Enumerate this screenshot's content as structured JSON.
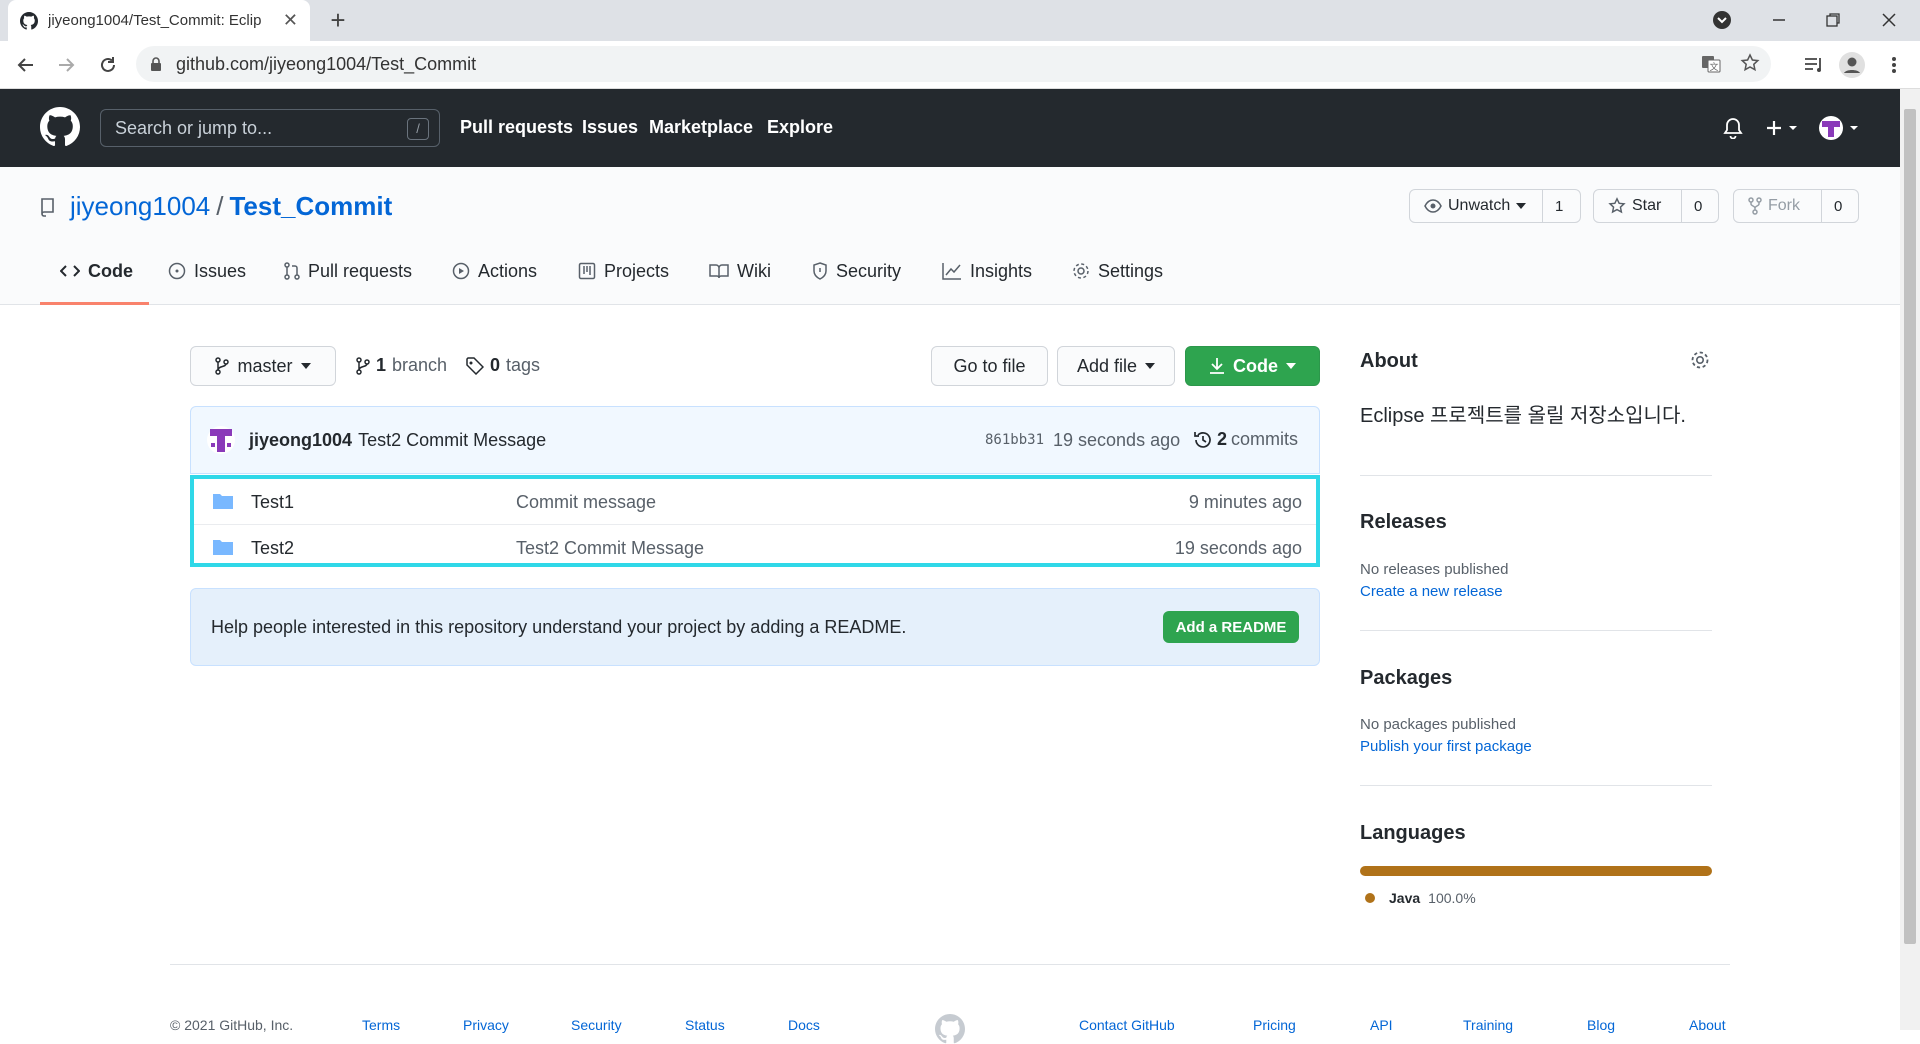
{
  "browser": {
    "tab_title": "jiyeong1004/Test_Commit: Eclip",
    "url": "github.com/jiyeong1004/Test_Commit",
    "new_tab": "+",
    "tab_close": "✕"
  },
  "header": {
    "search_placeholder": "Search or jump to...",
    "search_shortcut": "/",
    "nav": [
      "Pull requests",
      "Issues",
      "Marketplace",
      "Explore"
    ]
  },
  "repo": {
    "owner": "jiyeong1004",
    "separator": "/",
    "name": "Test_Commit",
    "unwatch_label": "Unwatch",
    "watch_count": "1",
    "star_label": "Star",
    "star_count": "0",
    "fork_label": "Fork",
    "fork_count": "0"
  },
  "tabs": [
    "Code",
    "Issues",
    "Pull requests",
    "Actions",
    "Projects",
    "Wiki",
    "Security",
    "Insights",
    "Settings"
  ],
  "toolbar": {
    "branch": "master",
    "branch_count": "1",
    "branch_label": "branch",
    "tag_count": "0",
    "tag_label": "tags",
    "go_to_file": "Go to file",
    "add_file": "Add file",
    "code": "Code"
  },
  "latest_commit": {
    "author": "jiyeong1004",
    "message": "Test2 Commit Message",
    "sha": "861bb31",
    "time": "19 seconds ago",
    "commit_count": "2",
    "commit_label": "commits"
  },
  "files": [
    {
      "name": "Test1",
      "message": "Commit message",
      "time": "9 minutes ago"
    },
    {
      "name": "Test2",
      "message": "Test2 Commit Message",
      "time": "19 seconds ago"
    }
  ],
  "readme": {
    "message": "Help people interested in this repository understand your project by adding a README.",
    "button": "Add a README"
  },
  "sidebar": {
    "about_title": "About",
    "about_text": "Eclipse 프로젝트를 올릴 저장소입니다.",
    "releases_title": "Releases",
    "releases_text": "No releases published",
    "releases_link": "Create a new release",
    "packages_title": "Packages",
    "packages_text": "No packages published",
    "packages_link": "Publish your first package",
    "languages_title": "Languages",
    "language_name": "Java",
    "language_percent": "100.0%",
    "language_share": 1.0,
    "language_color": "#b07219"
  },
  "footer": {
    "copyright": "© 2021 GitHub, Inc.",
    "links_left": [
      "Terms",
      "Privacy",
      "Security",
      "Status",
      "Docs"
    ],
    "links_right": [
      "Contact GitHub",
      "Pricing",
      "API",
      "Training",
      "Blog",
      "About"
    ]
  }
}
